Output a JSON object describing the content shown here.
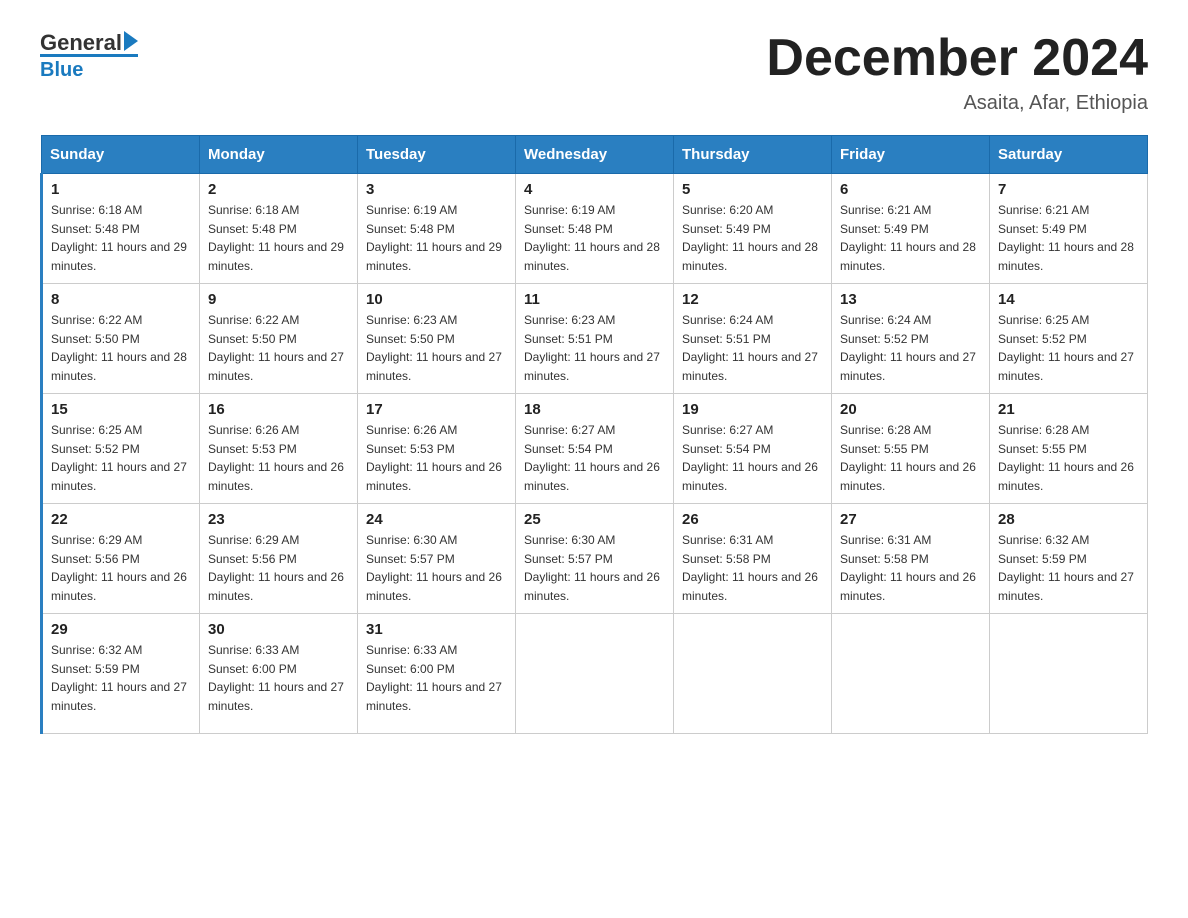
{
  "header": {
    "logo_text": "General",
    "logo_blue": "Blue",
    "month_title": "December 2024",
    "location": "Asaita, Afar, Ethiopia"
  },
  "weekdays": [
    "Sunday",
    "Monday",
    "Tuesday",
    "Wednesday",
    "Thursday",
    "Friday",
    "Saturday"
  ],
  "weeks": [
    [
      {
        "day": "1",
        "sunrise": "6:18 AM",
        "sunset": "5:48 PM",
        "daylight": "11 hours and 29 minutes."
      },
      {
        "day": "2",
        "sunrise": "6:18 AM",
        "sunset": "5:48 PM",
        "daylight": "11 hours and 29 minutes."
      },
      {
        "day": "3",
        "sunrise": "6:19 AM",
        "sunset": "5:48 PM",
        "daylight": "11 hours and 29 minutes."
      },
      {
        "day": "4",
        "sunrise": "6:19 AM",
        "sunset": "5:48 PM",
        "daylight": "11 hours and 28 minutes."
      },
      {
        "day": "5",
        "sunrise": "6:20 AM",
        "sunset": "5:49 PM",
        "daylight": "11 hours and 28 minutes."
      },
      {
        "day": "6",
        "sunrise": "6:21 AM",
        "sunset": "5:49 PM",
        "daylight": "11 hours and 28 minutes."
      },
      {
        "day": "7",
        "sunrise": "6:21 AM",
        "sunset": "5:49 PM",
        "daylight": "11 hours and 28 minutes."
      }
    ],
    [
      {
        "day": "8",
        "sunrise": "6:22 AM",
        "sunset": "5:50 PM",
        "daylight": "11 hours and 28 minutes."
      },
      {
        "day": "9",
        "sunrise": "6:22 AM",
        "sunset": "5:50 PM",
        "daylight": "11 hours and 27 minutes."
      },
      {
        "day": "10",
        "sunrise": "6:23 AM",
        "sunset": "5:50 PM",
        "daylight": "11 hours and 27 minutes."
      },
      {
        "day": "11",
        "sunrise": "6:23 AM",
        "sunset": "5:51 PM",
        "daylight": "11 hours and 27 minutes."
      },
      {
        "day": "12",
        "sunrise": "6:24 AM",
        "sunset": "5:51 PM",
        "daylight": "11 hours and 27 minutes."
      },
      {
        "day": "13",
        "sunrise": "6:24 AM",
        "sunset": "5:52 PM",
        "daylight": "11 hours and 27 minutes."
      },
      {
        "day": "14",
        "sunrise": "6:25 AM",
        "sunset": "5:52 PM",
        "daylight": "11 hours and 27 minutes."
      }
    ],
    [
      {
        "day": "15",
        "sunrise": "6:25 AM",
        "sunset": "5:52 PM",
        "daylight": "11 hours and 27 minutes."
      },
      {
        "day": "16",
        "sunrise": "6:26 AM",
        "sunset": "5:53 PM",
        "daylight": "11 hours and 26 minutes."
      },
      {
        "day": "17",
        "sunrise": "6:26 AM",
        "sunset": "5:53 PM",
        "daylight": "11 hours and 26 minutes."
      },
      {
        "day": "18",
        "sunrise": "6:27 AM",
        "sunset": "5:54 PM",
        "daylight": "11 hours and 26 minutes."
      },
      {
        "day": "19",
        "sunrise": "6:27 AM",
        "sunset": "5:54 PM",
        "daylight": "11 hours and 26 minutes."
      },
      {
        "day": "20",
        "sunrise": "6:28 AM",
        "sunset": "5:55 PM",
        "daylight": "11 hours and 26 minutes."
      },
      {
        "day": "21",
        "sunrise": "6:28 AM",
        "sunset": "5:55 PM",
        "daylight": "11 hours and 26 minutes."
      }
    ],
    [
      {
        "day": "22",
        "sunrise": "6:29 AM",
        "sunset": "5:56 PM",
        "daylight": "11 hours and 26 minutes."
      },
      {
        "day": "23",
        "sunrise": "6:29 AM",
        "sunset": "5:56 PM",
        "daylight": "11 hours and 26 minutes."
      },
      {
        "day": "24",
        "sunrise": "6:30 AM",
        "sunset": "5:57 PM",
        "daylight": "11 hours and 26 minutes."
      },
      {
        "day": "25",
        "sunrise": "6:30 AM",
        "sunset": "5:57 PM",
        "daylight": "11 hours and 26 minutes."
      },
      {
        "day": "26",
        "sunrise": "6:31 AM",
        "sunset": "5:58 PM",
        "daylight": "11 hours and 26 minutes."
      },
      {
        "day": "27",
        "sunrise": "6:31 AM",
        "sunset": "5:58 PM",
        "daylight": "11 hours and 26 minutes."
      },
      {
        "day": "28",
        "sunrise": "6:32 AM",
        "sunset": "5:59 PM",
        "daylight": "11 hours and 27 minutes."
      }
    ],
    [
      {
        "day": "29",
        "sunrise": "6:32 AM",
        "sunset": "5:59 PM",
        "daylight": "11 hours and 27 minutes."
      },
      {
        "day": "30",
        "sunrise": "6:33 AM",
        "sunset": "6:00 PM",
        "daylight": "11 hours and 27 minutes."
      },
      {
        "day": "31",
        "sunrise": "6:33 AM",
        "sunset": "6:00 PM",
        "daylight": "11 hours and 27 minutes."
      },
      {
        "day": "",
        "sunrise": "",
        "sunset": "",
        "daylight": ""
      },
      {
        "day": "",
        "sunrise": "",
        "sunset": "",
        "daylight": ""
      },
      {
        "day": "",
        "sunrise": "",
        "sunset": "",
        "daylight": ""
      },
      {
        "day": "",
        "sunrise": "",
        "sunset": "",
        "daylight": ""
      }
    ]
  ]
}
